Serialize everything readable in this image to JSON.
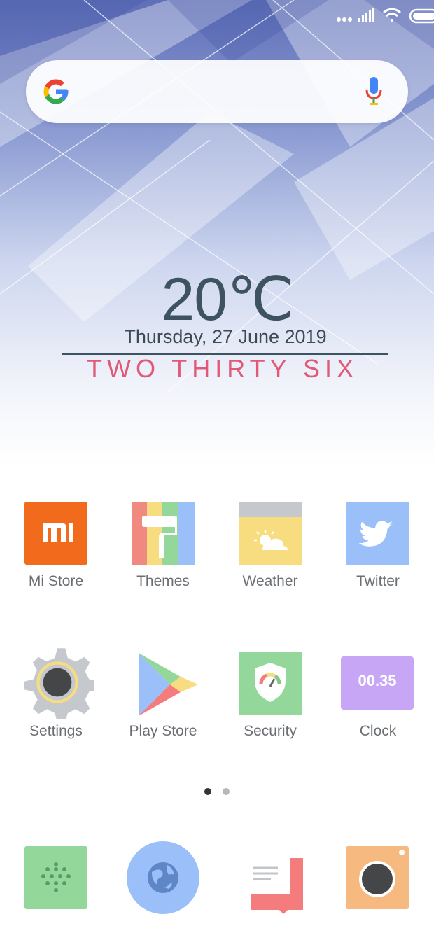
{
  "status_bar": {
    "icons": [
      "more-dots-icon",
      "signal-icon",
      "wifi-icon",
      "battery-icon"
    ]
  },
  "search": {
    "logo": "google-g-icon",
    "voice": "mic-icon"
  },
  "widget": {
    "temperature": "20℃",
    "date": "Thursday, 27 June 2019",
    "time_words": "TWO THIRTY SIX"
  },
  "apps": [
    {
      "label": "Mi Store",
      "icon": "mi-store-icon",
      "color": "#F26A1B"
    },
    {
      "label": "Themes",
      "icon": "themes-icon",
      "color": "#F08A80"
    },
    {
      "label": "Weather",
      "icon": "weather-icon",
      "color": "#F7DD80"
    },
    {
      "label": "Twitter",
      "icon": "twitter-icon",
      "color": "#9BBFF8"
    },
    {
      "label": "Settings",
      "icon": "settings-icon",
      "color": "#C5C8CD"
    },
    {
      "label": "Play Store",
      "icon": "play-store-icon",
      "color": "#7FC889"
    },
    {
      "label": "Security",
      "icon": "security-icon",
      "color": "#93D89A"
    },
    {
      "label": "Clock",
      "icon": "clock-icon",
      "color": "#C7A6F5",
      "text": "00.35"
    }
  ],
  "pager": {
    "pages": 2,
    "current": 1
  },
  "dock": [
    {
      "name": "phone-dialer-icon",
      "color": "#93D89A"
    },
    {
      "name": "browser-globe-icon",
      "color": "#9BBFF8"
    },
    {
      "name": "messages-icon",
      "color": "#F47C7C"
    },
    {
      "name": "camera-icon",
      "color": "#F6B97F"
    }
  ]
}
